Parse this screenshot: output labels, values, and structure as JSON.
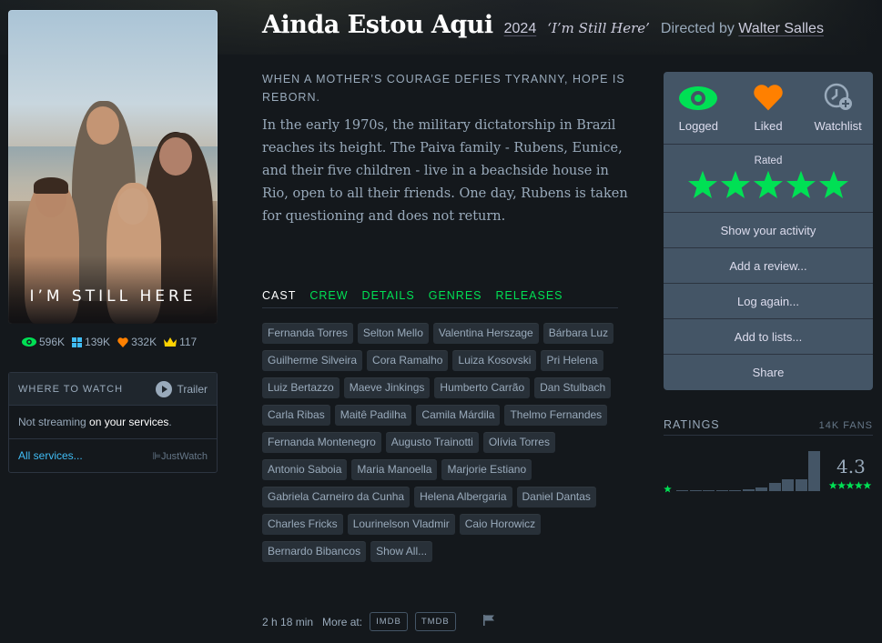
{
  "film": {
    "title": "Ainda Estou Aqui",
    "year": "2024",
    "original_title": "‘I’m Still Here’",
    "directed_by_label": "Directed by",
    "director": "Walter Salles",
    "tagline": "When a mother’s courage defies tyranny, hope is reborn.",
    "synopsis": "In the early 1970s, the military dictatorship in Brazil reaches its height. The Paiva family - Rubens, Eunice, and their five children - live in a beachside house in Rio, open to all their friends. One day, Rubens is taken for questioning and does not return.",
    "runtime": "2 h 18 min",
    "more_at_label": "More at:"
  },
  "poster": {
    "title_text": "I’M STILL HERE"
  },
  "stats": {
    "watched": "596K",
    "lists": "139K",
    "likes": "332K",
    "top": "117"
  },
  "where_to_watch": {
    "title": "WHERE TO WATCH",
    "trailer_label": "Trailer",
    "status_prefix": "Not streaming",
    "status_highlight": "on your services",
    "status_suffix": ".",
    "all_services": "All services...",
    "provider": "JustWatch"
  },
  "tabs": [
    {
      "label": "CAST",
      "active": true
    },
    {
      "label": "CREW",
      "active": false
    },
    {
      "label": "DETAILS",
      "active": false
    },
    {
      "label": "GENRES",
      "active": false
    },
    {
      "label": "RELEASES",
      "active": false
    }
  ],
  "cast": [
    "Fernanda Torres",
    "Selton Mello",
    "Valentina Herszage",
    "Bárbara Luz",
    "Guilherme Silveira",
    "Cora Ramalho",
    "Luiza Kosovski",
    "Pri Helena",
    "Luiz Bertazzo",
    "Maeve Jinkings",
    "Humberto Carrão",
    "Dan Stulbach",
    "Carla Ribas",
    "Maitê Padilha",
    "Camila Márdila",
    "Thelmo Fernandes",
    "Fernanda Montenegro",
    "Augusto Trainotti",
    "Olívia Torres",
    "Antonio Saboia",
    "Maria Manoella",
    "Marjorie Estiano",
    "Gabriela Carneiro da Cunha",
    "Helena Albergaria",
    "Daniel Dantas",
    "Charles Fricks",
    "Lourinelson Vladmir",
    "Caio Horowicz",
    "Bernardo Bibancos",
    "Show All..."
  ],
  "links": {
    "imdb": "IMDB",
    "tmdb": "TMDB"
  },
  "actions": {
    "logged": "Logged",
    "liked": "Liked",
    "watchlist": "Watchlist",
    "rated_label": "Rated",
    "rating_stars": 5,
    "show_activity": "Show your activity",
    "add_review": "Add a review...",
    "log_again": "Log again...",
    "add_to_lists": "Add to lists...",
    "share": "Share"
  },
  "ratings": {
    "title": "RATINGS",
    "fans": "14K FANS",
    "average": "4.3",
    "histogram": [
      0.01,
      0.01,
      0.01,
      0.02,
      0.02,
      0.04,
      0.06,
      0.16,
      0.22,
      0.22,
      0.74
    ]
  },
  "colors": {
    "background": "#14181c",
    "accent_green": "#00e054",
    "like_orange": "#ff8000",
    "link_blue": "#40bcf4",
    "panel": "#445566"
  }
}
